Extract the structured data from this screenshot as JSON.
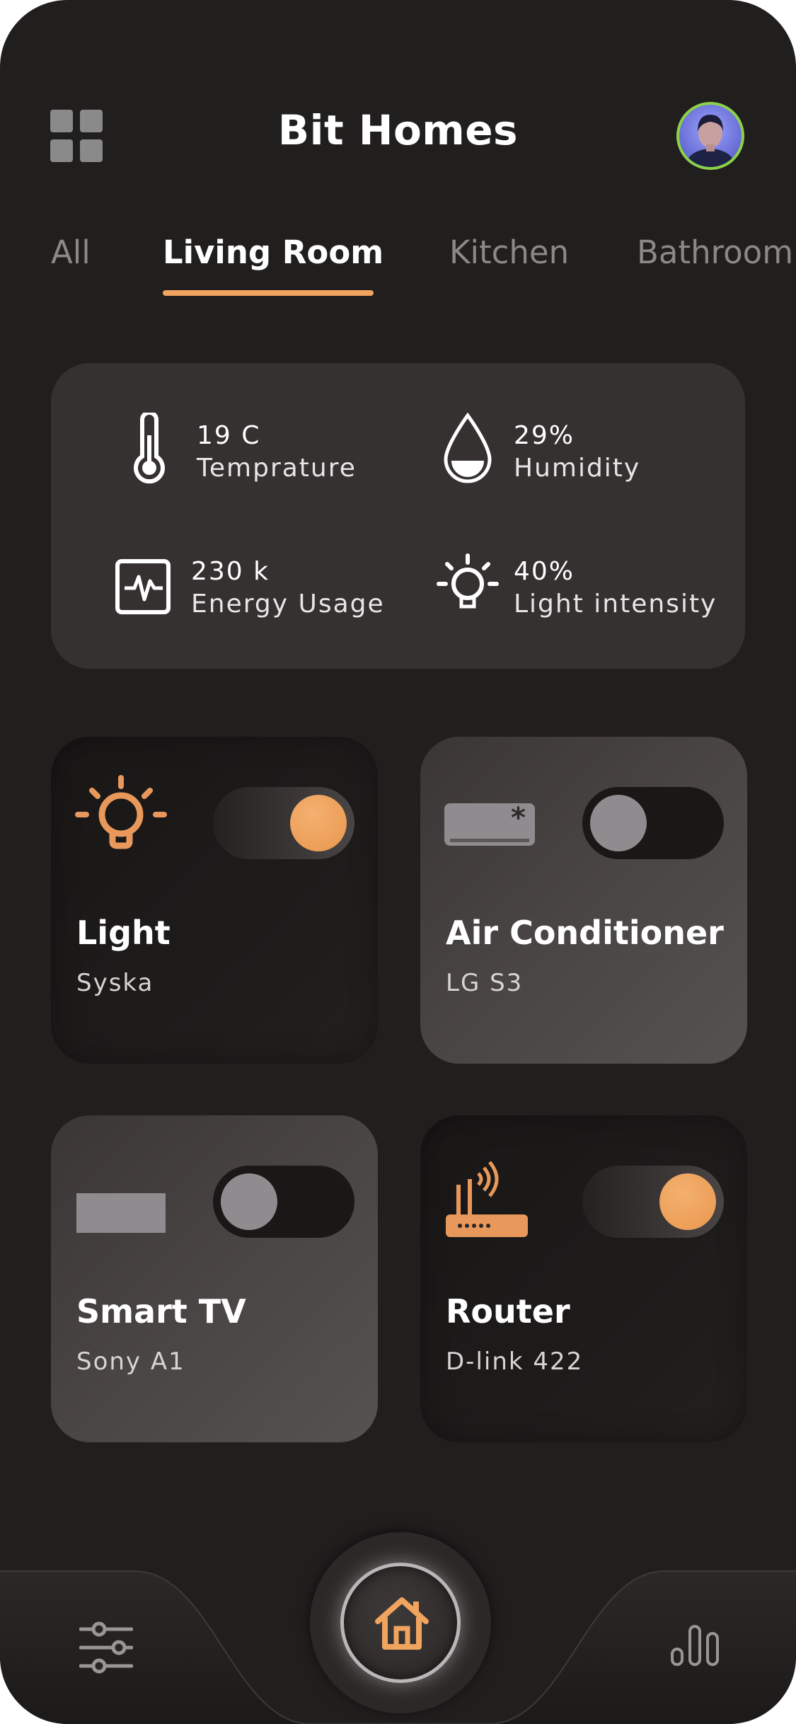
{
  "header": {
    "title": "Bit Homes"
  },
  "tabs": [
    {
      "label": "All"
    },
    {
      "label": "Living Room",
      "active": true
    },
    {
      "label": "Kitchen"
    },
    {
      "label": "Bathroom"
    }
  ],
  "stats": [
    {
      "value": "19 C",
      "label": "Temprature",
      "icon": "thermometer-icon"
    },
    {
      "value": "29%",
      "label": "Humidity",
      "icon": "droplet-icon"
    },
    {
      "value": "230 k",
      "label": "Energy Usage",
      "icon": "pulse-monitor-icon"
    },
    {
      "value": "40%",
      "label": "Light intensity",
      "icon": "bulb-icon"
    }
  ],
  "devices": [
    {
      "name": "Light",
      "model": "Syska",
      "on": true,
      "icon": "bulb-icon"
    },
    {
      "name": "Air Conditioner",
      "model": "LG S3",
      "on": false,
      "icon": "air-conditioner-icon"
    },
    {
      "name": "Smart TV",
      "model": "Sony A1",
      "on": false,
      "icon": "tv-icon"
    },
    {
      "name": "Router",
      "model": "D-link 422",
      "on": true,
      "icon": "router-icon"
    }
  ],
  "nav": {
    "left_icon": "sliders-icon",
    "center_icon": "home-icon",
    "right_icon": "bar-chart-icon"
  },
  "colors": {
    "background": "#211e1e",
    "panel": "#353131",
    "accent": "#f0a45e",
    "avatar_ring": "#8bd14a"
  }
}
